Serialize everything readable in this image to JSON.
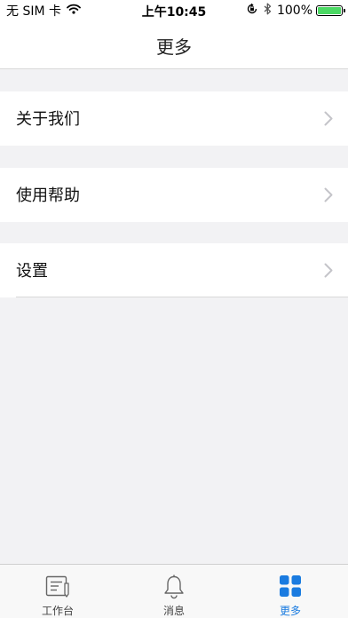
{
  "status_bar": {
    "carrier": "无 SIM 卡",
    "time": "上午10:45",
    "battery": "100%",
    "battery_level": 1.0,
    "battery_color": "#4cd964"
  },
  "nav": {
    "title": "更多"
  },
  "menu": {
    "items": [
      {
        "label": "关于我们",
        "icon": "chevron-right-icon"
      },
      {
        "label": "使用帮助",
        "icon": "chevron-right-icon"
      },
      {
        "label": "设置",
        "icon": "chevron-right-icon"
      }
    ]
  },
  "tabbar": {
    "active_color": "#1a7be0",
    "tabs": [
      {
        "label": "工作台",
        "icon": "workbench-icon",
        "active": false
      },
      {
        "label": "消息",
        "icon": "bell-icon",
        "active": false
      },
      {
        "label": "更多",
        "icon": "grid-icon",
        "active": true
      }
    ]
  }
}
